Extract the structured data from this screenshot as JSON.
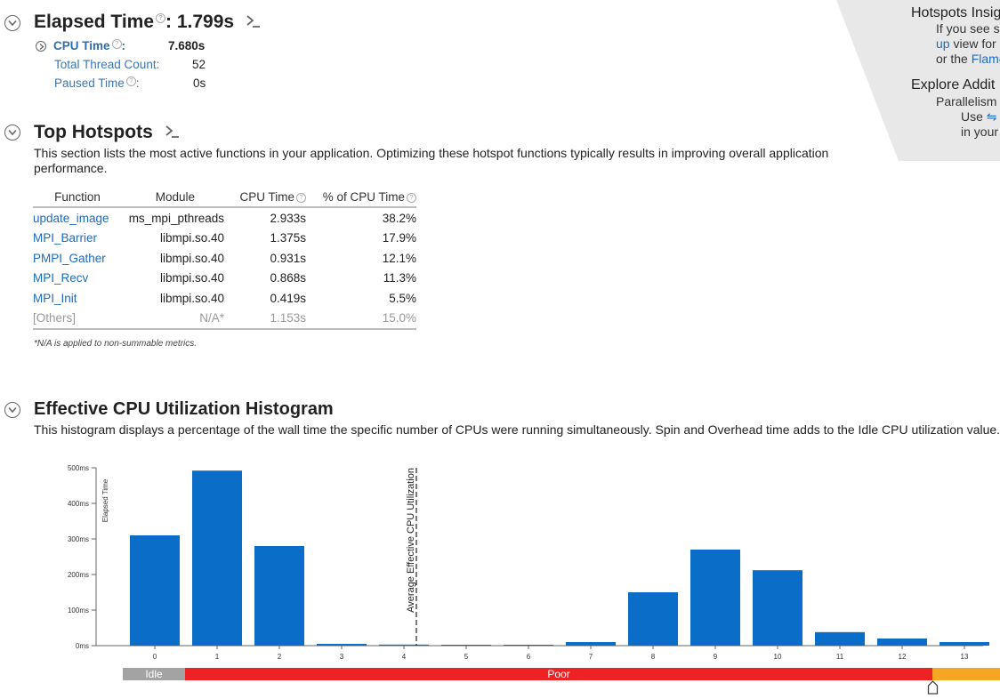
{
  "summary": {
    "elapsed_label": "Elapsed Time",
    "elapsed_value": ": 1.799s",
    "cpu_time_label": "CPU Time",
    "cpu_time_suffix": ":",
    "cpu_time_value": "7.680s",
    "thread_count_label": "Total Thread Count:",
    "thread_count_value": "52",
    "paused_label": "Paused Time",
    "paused_suffix": ":",
    "paused_value": "0s"
  },
  "hotspots": {
    "title": "Top Hotspots",
    "description": "This section lists the most active functions in your application. Optimizing these hotspot functions typically results in improving overall application performance.",
    "columns": [
      "Function",
      "Module",
      "CPU Time",
      "% of CPU Time"
    ],
    "rows": [
      {
        "function": "update_image",
        "module": "ms_mpi_pthreads",
        "cpu": "2.933s",
        "pct": "38.2%"
      },
      {
        "function": "MPI_Barrier",
        "module": "libmpi.so.40",
        "cpu": "1.375s",
        "pct": "17.9%"
      },
      {
        "function": "PMPI_Gather",
        "module": "libmpi.so.40",
        "cpu": "0.931s",
        "pct": "12.1%"
      },
      {
        "function": "MPI_Recv",
        "module": "libmpi.so.40",
        "cpu": "0.868s",
        "pct": "11.3%"
      },
      {
        "function": "MPI_Init",
        "module": "libmpi.so.40",
        "cpu": "0.419s",
        "pct": "5.5%"
      },
      {
        "function": "[Others]",
        "module": "N/A*",
        "cpu": "1.153s",
        "pct": "15.0%"
      }
    ],
    "note": "*N/A is applied to non-summable metrics."
  },
  "panel": {
    "heading1": "Hotspots Insig",
    "line1": "If you see s",
    "line2_link": "up",
    "line2_rest": " view for",
    "line3_pre": "or the ",
    "line3_link": "Flame",
    "heading2": "Explore Addit",
    "line4": "Parallelism",
    "line5": "Use",
    "line6": "in your"
  },
  "histogram": {
    "title": "Effective CPU Utilization Histogram",
    "description": "This histogram displays a percentage of the wall time the specific number of CPUs were running simultaneously. Spin and Overhead time adds to the Idle CPU utilization value.",
    "idle_label": "Idle",
    "poor_label": "Poor",
    "colors": {
      "bar": "#0a6ec8",
      "idle": "#a3a3a3",
      "poor": "#ee2222",
      "ok": "#f6a623"
    }
  },
  "chart_data": {
    "type": "bar",
    "title": "Effective CPU Utilization Histogram",
    "xlabel": "",
    "ylabel": "Elapsed Time",
    "categories": [
      "0",
      "1",
      "2",
      "3",
      "4",
      "5",
      "6",
      "7",
      "8",
      "9",
      "10",
      "11",
      "12",
      "13"
    ],
    "values": [
      310,
      492,
      280,
      5,
      3,
      2,
      2,
      10,
      150,
      270,
      212,
      38,
      20,
      10
    ],
    "ylim": [
      0,
      500
    ],
    "yticks": [
      "0ms",
      "100ms",
      "200ms",
      "300ms",
      "400ms",
      "500ms"
    ],
    "marker_label": "Average Effective CPU Utilization",
    "marker_x": 4.2
  }
}
